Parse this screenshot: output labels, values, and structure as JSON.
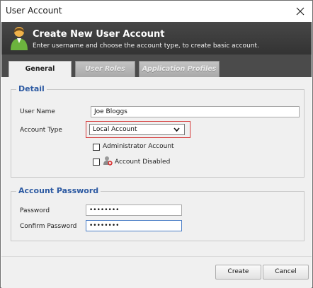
{
  "window": {
    "title": "User Account"
  },
  "header": {
    "title": "Create New User Account",
    "subtitle": "Enter username and choose the account type, to create basic account."
  },
  "tabs": [
    {
      "label": "General",
      "active": true
    },
    {
      "label": "User Roles",
      "active": false
    },
    {
      "label": "Application Profiles",
      "active": false
    }
  ],
  "detail": {
    "legend": "Detail",
    "username_label": "User Name",
    "username_value": "Joe Bloggs",
    "account_type_label": "Account Type",
    "account_type_value": "Local Account",
    "admin_checkbox_label": "Administrator Account",
    "admin_checked": false,
    "disabled_checkbox_label": "Account Disabled",
    "disabled_checked": false
  },
  "password": {
    "legend": "Account Password",
    "password_label": "Password",
    "password_value": "••••••••",
    "confirm_label": "Confirm Password",
    "confirm_value": "••••••••"
  },
  "footer": {
    "create_label": "Create",
    "cancel_label": "Cancel"
  },
  "icons": {
    "close": "close-icon",
    "user": "user-icon",
    "dropdown": "chevron-down-icon",
    "disabled": "user-disabled-icon"
  },
  "colors": {
    "header_bg": "#3c3c3c",
    "legend_text": "#2d5aa2",
    "select_highlight": "#d63a3a",
    "user_icon_green": "#6cb33e"
  }
}
